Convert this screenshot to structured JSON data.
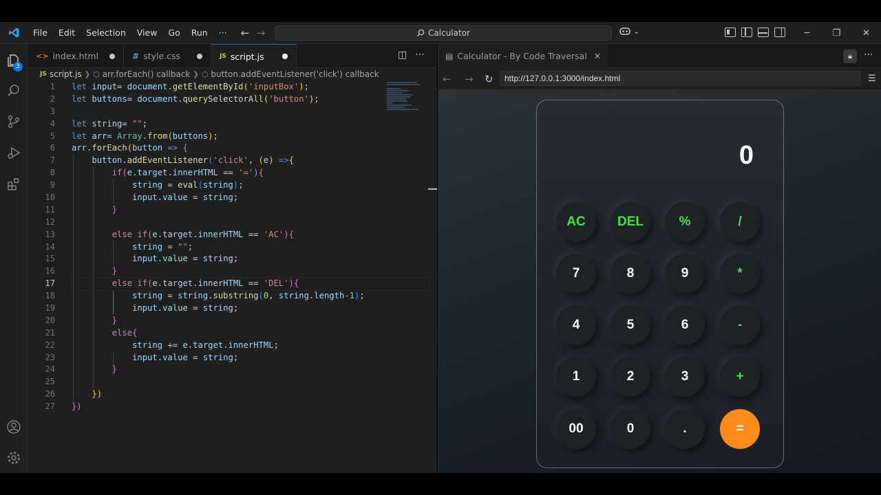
{
  "menu": [
    "File",
    "Edit",
    "Selection",
    "View",
    "Go",
    "Run",
    "···"
  ],
  "command_center": "Calculator",
  "activity": {
    "badge": "3"
  },
  "tabs": [
    {
      "icon": "<>",
      "label": "index.html"
    },
    {
      "icon": "#",
      "label": "style.css"
    },
    {
      "icon": "JS",
      "label": "script.js"
    }
  ],
  "breadcrumb": {
    "file": "script.js",
    "sym1": "arr.forEach() callback",
    "sym2": "button.addEventListener('click') callback"
  },
  "editor": {
    "line_numbers": [
      "1",
      "2",
      "3",
      "4",
      "5",
      "6",
      "7",
      "8",
      "9",
      "10",
      "11",
      "12",
      "13",
      "14",
      "15",
      "16",
      "17",
      "18",
      "19",
      "20",
      "21",
      "22",
      "23",
      "24",
      "25",
      "26",
      "27"
    ],
    "current_line": "17",
    "lines": [
      [
        [
          "kw",
          "let "
        ],
        [
          "vr",
          "input"
        ],
        [
          "",
          "= "
        ],
        [
          "vr",
          "document"
        ],
        [
          "",
          "."
        ],
        [
          "fn",
          "getElementById"
        ],
        [
          "br1",
          "("
        ],
        [
          "str",
          "'inputBox'"
        ],
        [
          "br1",
          ")"
        ],
        [
          "",
          ";"
        ]
      ],
      [
        [
          "kw",
          "let "
        ],
        [
          "vr",
          "buttons"
        ],
        [
          "",
          "= "
        ],
        [
          "vr",
          "document"
        ],
        [
          "",
          "."
        ],
        [
          "fn",
          "querySelectorAll"
        ],
        [
          "br1",
          "("
        ],
        [
          "str",
          "'button'"
        ],
        [
          "br1",
          ")"
        ],
        [
          "",
          ";"
        ]
      ],
      [],
      [
        [
          "kw",
          "let "
        ],
        [
          "vr",
          "string"
        ],
        [
          "",
          "= "
        ],
        [
          "str",
          "\"\""
        ],
        [
          "",
          ";"
        ]
      ],
      [
        [
          "kw",
          "let "
        ],
        [
          "vr",
          "arr"
        ],
        [
          "",
          "= "
        ],
        [
          "cls",
          "Array"
        ],
        [
          "",
          "."
        ],
        [
          "fn",
          "from"
        ],
        [
          "br1",
          "("
        ],
        [
          "vr",
          "buttons"
        ],
        [
          "br1",
          ")"
        ],
        [
          "",
          ";"
        ]
      ],
      [
        [
          "vr",
          "arr"
        ],
        [
          "",
          "."
        ],
        [
          "fn",
          "forEach"
        ],
        [
          "br1",
          "("
        ],
        [
          "vr",
          "button"
        ],
        [
          "kw",
          " => "
        ],
        [
          "br2",
          "{"
        ]
      ],
      [
        [
          "",
          "    "
        ],
        [
          "vr",
          "button"
        ],
        [
          "",
          "."
        ],
        [
          "fn",
          "addEventListener"
        ],
        [
          "br3",
          "("
        ],
        [
          "str",
          "'click'"
        ],
        [
          "",
          ", "
        ],
        [
          "br1",
          "("
        ],
        [
          "vr",
          "e"
        ],
        [
          "br1",
          ")"
        ],
        [
          "kw",
          " =>"
        ],
        [
          "br1",
          "{"
        ]
      ],
      [
        [
          "",
          "        "
        ],
        [
          "kw2",
          "if"
        ],
        [
          "br2",
          "("
        ],
        [
          "vr",
          "e"
        ],
        [
          "",
          "."
        ],
        [
          "vr",
          "target"
        ],
        [
          "",
          "."
        ],
        [
          "vr",
          "innerHTML"
        ],
        [
          "",
          " == "
        ],
        [
          "str",
          "'='"
        ],
        [
          "br2",
          ")"
        ],
        [
          "br2",
          "{"
        ]
      ],
      [
        [
          "",
          "            "
        ],
        [
          "vr",
          "string"
        ],
        [
          "",
          " = "
        ],
        [
          "fn",
          "eval"
        ],
        [
          "br3",
          "("
        ],
        [
          "vr",
          "string"
        ],
        [
          "br3",
          ")"
        ],
        [
          "",
          ";"
        ]
      ],
      [
        [
          "",
          "            "
        ],
        [
          "vr",
          "input"
        ],
        [
          "",
          "."
        ],
        [
          "vr",
          "value"
        ],
        [
          "",
          " = "
        ],
        [
          "vr",
          "string"
        ],
        [
          "",
          ";"
        ]
      ],
      [
        [
          "",
          "        "
        ],
        [
          "br2",
          "}"
        ]
      ],
      [],
      [
        [
          "",
          "        "
        ],
        [
          "kw2",
          "else if"
        ],
        [
          "br2",
          "("
        ],
        [
          "vr",
          "e"
        ],
        [
          "",
          "."
        ],
        [
          "vr",
          "target"
        ],
        [
          "",
          "."
        ],
        [
          "vr",
          "innerHTML"
        ],
        [
          "",
          " == "
        ],
        [
          "str",
          "'AC'"
        ],
        [
          "br2",
          ")"
        ],
        [
          "br2",
          "{"
        ]
      ],
      [
        [
          "",
          "            "
        ],
        [
          "vr",
          "string"
        ],
        [
          "",
          " = "
        ],
        [
          "str",
          "\"\""
        ],
        [
          "",
          ";"
        ]
      ],
      [
        [
          "",
          "            "
        ],
        [
          "vr",
          "input"
        ],
        [
          "",
          "."
        ],
        [
          "vr",
          "value"
        ],
        [
          "",
          " = "
        ],
        [
          "vr",
          "string"
        ],
        [
          "",
          ";"
        ]
      ],
      [
        [
          "",
          "        "
        ],
        [
          "br2",
          "}"
        ]
      ],
      [
        [
          "",
          "        "
        ],
        [
          "kw2",
          "else if"
        ],
        [
          "br2",
          "("
        ],
        [
          "vr",
          "e"
        ],
        [
          "",
          "."
        ],
        [
          "vr",
          "target"
        ],
        [
          "",
          "."
        ],
        [
          "vr",
          "innerHTML"
        ],
        [
          "",
          " == "
        ],
        [
          "str",
          "'DEL'"
        ],
        [
          "br2",
          ")"
        ],
        [
          "br2",
          "{"
        ]
      ],
      [
        [
          "",
          "            "
        ],
        [
          "vr",
          "string"
        ],
        [
          "",
          " = "
        ],
        [
          "vr",
          "string"
        ],
        [
          "",
          "."
        ],
        [
          "fn",
          "substring"
        ],
        [
          "br3",
          "("
        ],
        [
          "num",
          "0"
        ],
        [
          "",
          ", "
        ],
        [
          "vr",
          "string"
        ],
        [
          "",
          "."
        ],
        [
          "vr",
          "length"
        ],
        [
          "",
          "-"
        ],
        [
          "num",
          "1"
        ],
        [
          "br3",
          ")"
        ],
        [
          "",
          ";"
        ]
      ],
      [
        [
          "",
          "            "
        ],
        [
          "vr",
          "input"
        ],
        [
          "",
          "."
        ],
        [
          "vr",
          "value"
        ],
        [
          "",
          " = "
        ],
        [
          "vr",
          "string"
        ],
        [
          "",
          ";"
        ]
      ],
      [
        [
          "",
          "        "
        ],
        [
          "br2",
          "}"
        ]
      ],
      [
        [
          "",
          "        "
        ],
        [
          "kw2",
          "else"
        ],
        [
          "br2",
          "{"
        ]
      ],
      [
        [
          "",
          "            "
        ],
        [
          "vr",
          "string"
        ],
        [
          "",
          " += "
        ],
        [
          "vr",
          "e"
        ],
        [
          "",
          "."
        ],
        [
          "vr",
          "target"
        ],
        [
          "",
          "."
        ],
        [
          "vr",
          "innerHTML"
        ],
        [
          "",
          ";"
        ]
      ],
      [
        [
          "",
          "            "
        ],
        [
          "vr",
          "input"
        ],
        [
          "",
          "."
        ],
        [
          "vr",
          "value"
        ],
        [
          "",
          " = "
        ],
        [
          "vr",
          "string"
        ],
        [
          "",
          ";"
        ]
      ],
      [
        [
          "",
          "        "
        ],
        [
          "br2",
          "}"
        ]
      ],
      [],
      [
        [
          "",
          "    "
        ],
        [
          "br1",
          "})"
        ]
      ],
      [
        [
          "br2",
          "})"
        ]
      ]
    ]
  },
  "preview": {
    "tab_title": "Calculator - By Code Traversal",
    "url": "http://127.0.0.1:3000/index.html",
    "display_value": "0",
    "keys": [
      [
        "AC",
        "DEL",
        "%",
        "/"
      ],
      [
        "7",
        "8",
        "9",
        "*"
      ],
      [
        "4",
        "5",
        "6",
        "-"
      ],
      [
        "1",
        "2",
        "3",
        "+"
      ],
      [
        "00",
        "0",
        ".",
        "="
      ]
    ],
    "op_keys": [
      "AC",
      "DEL",
      "%",
      "/",
      "*",
      "-",
      "+"
    ],
    "colors": {
      "operator": "#3ee63e",
      "equals": "#ff8c1a",
      "accent": "#0078d4"
    }
  }
}
